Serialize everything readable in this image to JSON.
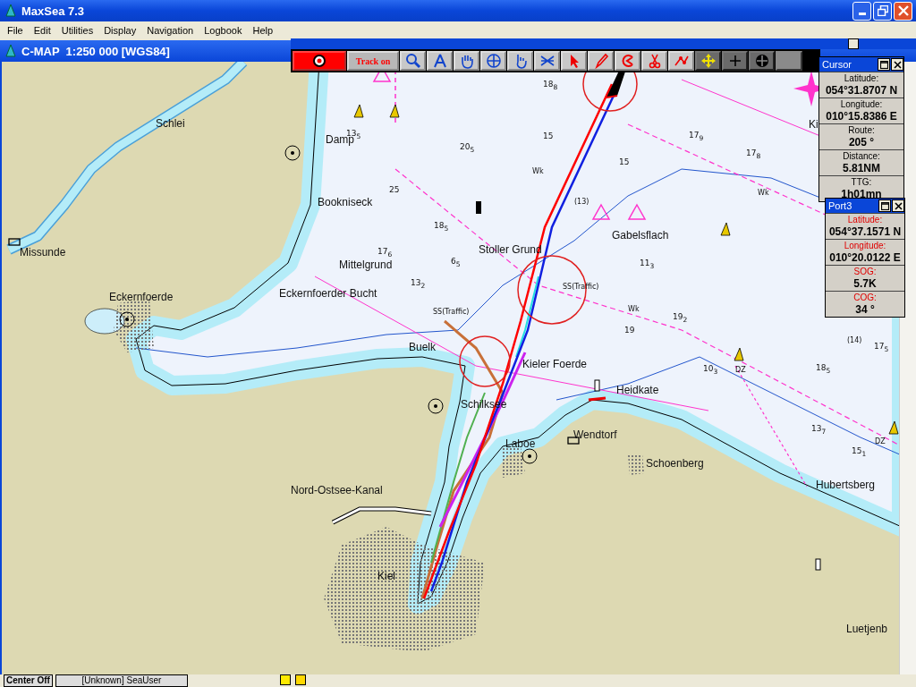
{
  "window": {
    "title": "MaxSea 7.3"
  },
  "menu": [
    "File",
    "Edit",
    "Utilities",
    "Display",
    "Navigation",
    "Logbook",
    "Help"
  ],
  "chart_window": {
    "title": "C-MAP  1:250 000 [WGS84]"
  },
  "toolbar": {
    "track_label": "Track on"
  },
  "map": {
    "place_names": [
      "Schlei",
      "Damp",
      "Bookniseck",
      "Missunde",
      "Mittelgrund",
      "Stoller Grund",
      "Gabelsflach",
      "Eckernfoerde",
      "Eckernfoerder Bucht",
      "Buelk",
      "Kieler Foerde",
      "Heidkate",
      "Schilksee",
      "Laboe",
      "Wendtorf",
      "Schoenberg",
      "Nord-Ostsee-Kanal",
      "Hubertsberg",
      "Kiel",
      "Luetjenb",
      "Ki"
    ],
    "soundings": [
      "18$_{8}$",
      "15",
      "20$_{5}$",
      "13$_{5}$",
      "25",
      "18$_{5}$",
      "17$_{6}$",
      "6$_{5}$",
      "13$_{2}$",
      "15",
      "17$_{9}$",
      "17$_{8}$",
      "11$_{3}$",
      "19",
      "19$_{2}$",
      "10$_{3}$",
      "18$_{5}$",
      "17$_{5}$",
      "13$_{7}$",
      "15$_{1}$"
    ],
    "marks": [
      "SS(Traffic)",
      "SS(Traffic)",
      "(13)",
      "(14)",
      "DZ",
      "DZ",
      "Wk",
      "Wk",
      "Wk"
    ]
  },
  "panels": [
    {
      "kind": "cursor",
      "title": "Cursor",
      "fields": [
        {
          "label": "Latitude:",
          "value": "054°31.8707 N"
        },
        {
          "label": "Longitude:",
          "value": "010°15.8386 E"
        },
        {
          "label": "Route:",
          "value": "205 °"
        },
        {
          "label": "Distance:",
          "value": "5.81NM"
        },
        {
          "label": "TTG:",
          "value": "1h01mn"
        }
      ]
    },
    {
      "kind": "port",
      "title": "Port3",
      "fields": [
        {
          "label": "Latitude:",
          "value": "054°37.1571 N"
        },
        {
          "label": "Longitude:",
          "value": "010°20.0122 E"
        },
        {
          "label": "SOG:",
          "value": "5.7K"
        },
        {
          "label": "COG:",
          "value": "34 °"
        }
      ]
    }
  ],
  "status_bar": {
    "mode": "Center Off",
    "user": "[Unknown] SeaUser"
  }
}
